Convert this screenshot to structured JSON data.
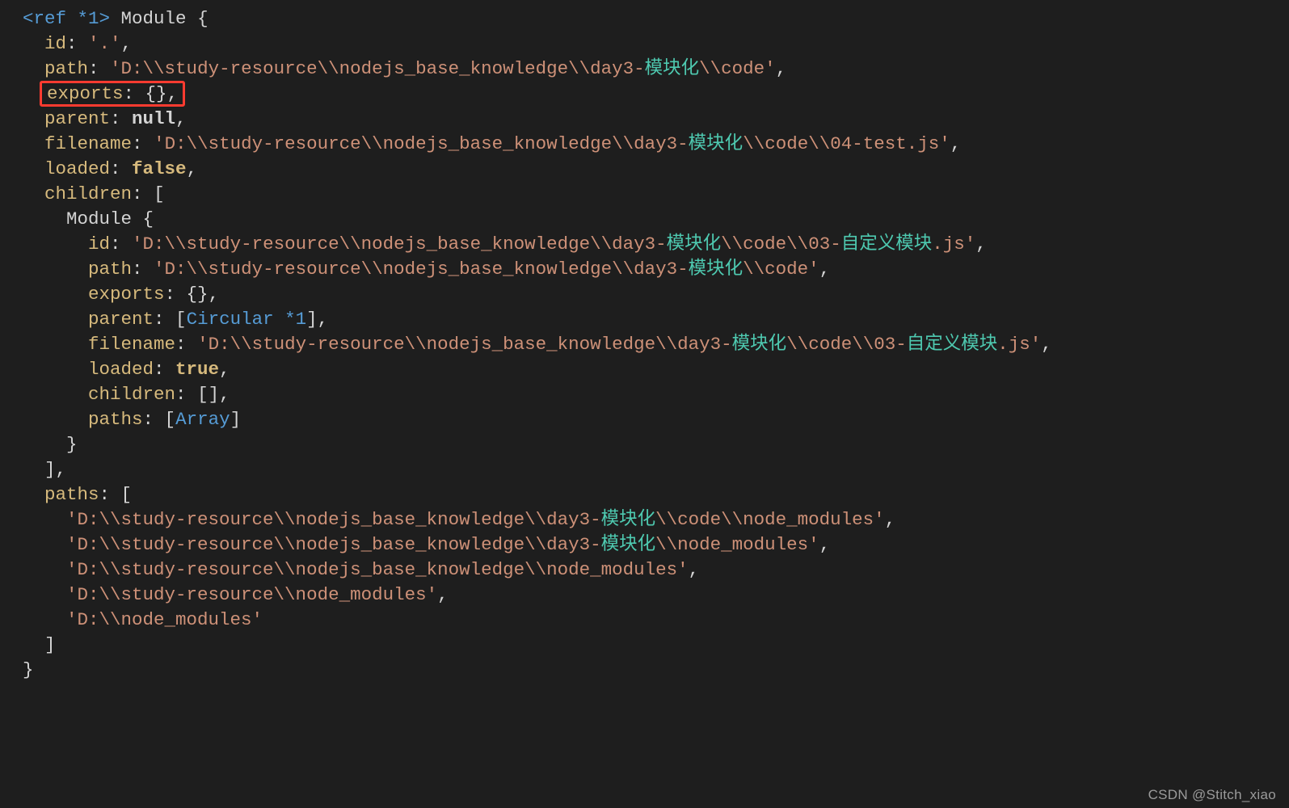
{
  "code": {
    "ref_tag": "<ref *1>",
    "module_word": " Module ",
    "brace_open": "{",
    "line_id": {
      "key": "id",
      "colon": ": ",
      "val": "'.'",
      "comma": ","
    },
    "line_path": {
      "key": "path",
      "colon": ": ",
      "pre": "'D:\\\\study-resource\\\\nodejs_base_knowledge\\\\day3-",
      "cjk": "模块化",
      "post": "\\\\code'",
      "comma": ","
    },
    "line_exports": {
      "key": "exports",
      "colon": ": ",
      "val": "{}",
      "comma": ","
    },
    "line_parent": {
      "key": "parent",
      "colon": ": ",
      "val": "null",
      "comma": ","
    },
    "line_filename": {
      "key": "filename",
      "colon": ": ",
      "pre": "'D:\\\\study-resource\\\\nodejs_base_knowledge\\\\day3-",
      "cjk": "模块化",
      "post": "\\\\code\\\\04-test.js'",
      "comma": ","
    },
    "line_loaded": {
      "key": "loaded",
      "colon": ": ",
      "val": "false",
      "comma": ","
    },
    "line_children": {
      "key": "children",
      "colon": ": ",
      "open": "["
    },
    "child": {
      "mod": "Module ",
      "brace": "{",
      "id": {
        "key": "id",
        "colon": ": ",
        "pre": "'D:\\\\study-resource\\\\nodejs_base_knowledge\\\\day3-",
        "cjk1": "模块化",
        "mid": "\\\\code\\\\03-",
        "cjk2": "自定义模块",
        "post": ".js'",
        "comma": ","
      },
      "path": {
        "key": "path",
        "colon": ": ",
        "pre": "'D:\\\\study-resource\\\\nodejs_base_knowledge\\\\day3-",
        "cjk": "模块化",
        "post": "\\\\code'",
        "comma": ","
      },
      "exports": {
        "key": "exports",
        "colon": ": ",
        "val": "{}",
        "comma": ","
      },
      "parent": {
        "key": "parent",
        "colon": ": ",
        "open": "[",
        "val": "Circular *1",
        "close": "]",
        "comma": ","
      },
      "filename": {
        "key": "filename",
        "colon": ": ",
        "pre": "'D:\\\\study-resource\\\\nodejs_base_knowledge\\\\day3-",
        "cjk1": "模块化",
        "mid": "\\\\code\\\\03-",
        "cjk2": "自定义模块",
        "post": ".js'",
        "comma": ","
      },
      "loaded": {
        "key": "loaded",
        "colon": ": ",
        "val": "true",
        "comma": ","
      },
      "children": {
        "key": "children",
        "colon": ": ",
        "val": "[]",
        "comma": ","
      },
      "paths": {
        "key": "paths",
        "colon": ": ",
        "open": "[",
        "val": "Array",
        "close": "]"
      },
      "brace_close": "}"
    },
    "children_close": "],",
    "line_paths": {
      "key": "paths",
      "colon": ": ",
      "open": "["
    },
    "paths_list": [
      {
        "pre": "'D:\\\\study-resource\\\\nodejs_base_knowledge\\\\day3-",
        "cjk": "模块化",
        "post": "\\\\code\\\\node_modules'",
        "comma": ","
      },
      {
        "pre": "'D:\\\\study-resource\\\\nodejs_base_knowledge\\\\day3-",
        "cjk": "模块化",
        "post": "\\\\node_modules'",
        "comma": ","
      },
      {
        "pre": "'D:\\\\study-resource\\\\nodejs_base_knowledge\\\\node_modules'",
        "cjk": "",
        "post": "",
        "comma": ","
      },
      {
        "pre": "'D:\\\\study-resource\\\\node_modules'",
        "cjk": "",
        "post": "",
        "comma": ","
      },
      {
        "pre": "'D:\\\\node_modules'",
        "cjk": "",
        "post": "",
        "comma": ""
      }
    ],
    "paths_close": "]",
    "brace_close": "}"
  },
  "watermark": "CSDN @Stitch_xiao"
}
